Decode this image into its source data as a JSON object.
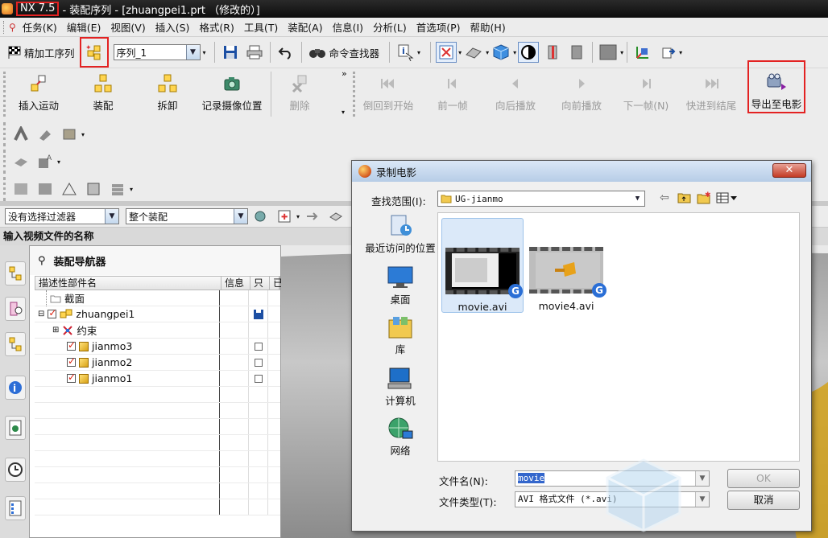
{
  "window": {
    "app_badge": "NX 7.5",
    "title_rest": "- 装配序列 - [zhuangpei1.prt （修改的）]"
  },
  "menu": [
    "任务(K)",
    "编辑(E)",
    "视图(V)",
    "插入(S)",
    "格式(R)",
    "工具(T)",
    "装配(A)",
    "信息(I)",
    "分析(L)",
    "首选项(P)",
    "帮助(H)"
  ],
  "toolbar1": {
    "finish_label": "精加工序列",
    "sequence_value": "序列_1",
    "command_finder": "命令查找器"
  },
  "toolbar2": {
    "buttons": [
      {
        "label": "插入运动",
        "enabled": true
      },
      {
        "label": "装配",
        "enabled": true
      },
      {
        "label": "拆卸",
        "enabled": true
      },
      {
        "label": "记录摄像位置",
        "enabled": true
      },
      {
        "label": "删除",
        "enabled": false
      },
      {
        "label": "倒回到开始",
        "enabled": false
      },
      {
        "label": "前一帧",
        "enabled": false
      },
      {
        "label": "向后播放",
        "enabled": false
      },
      {
        "label": "向前播放",
        "enabled": false
      },
      {
        "label": "下一帧(N)",
        "enabled": false
      },
      {
        "label": "快进到结尾",
        "enabled": false
      },
      {
        "label": "导出至电影",
        "enabled": true
      }
    ]
  },
  "filter": {
    "selection_filter": "没有选择过滤器",
    "scope": "整个装配"
  },
  "prompt": "输入视频文件的名称",
  "navigator": {
    "title": "装配导航器",
    "columns": [
      "描述性部件名",
      "信息",
      "只",
      "已"
    ],
    "rows": [
      {
        "name": "截面",
        "level": 1
      },
      {
        "name": "zhuangpei1",
        "level": 0
      },
      {
        "name": "约束",
        "level": 1
      },
      {
        "name": "jianmo3",
        "level": 2
      },
      {
        "name": "jianmo2",
        "level": 2
      },
      {
        "name": "jianmo1",
        "level": 2
      }
    ]
  },
  "dialog": {
    "title": "录制电影",
    "look_in_label": "查找范围(I):",
    "look_in_value": "UG-jianmo",
    "places": [
      "最近访问的位置",
      "桌面",
      "库",
      "计算机",
      "网络"
    ],
    "files": [
      "movie.avi",
      "movie4.avi"
    ],
    "filename_label": "文件名(N):",
    "filename_value": "movie",
    "filetype_label": "文件类型(T):",
    "filetype_value": "AVI 格式文件 (*.avi)",
    "ok_label": "OK",
    "cancel_label": "取消"
  },
  "colors": {
    "highlight_red": "#e32222",
    "selection_blue": "#3366cc"
  }
}
